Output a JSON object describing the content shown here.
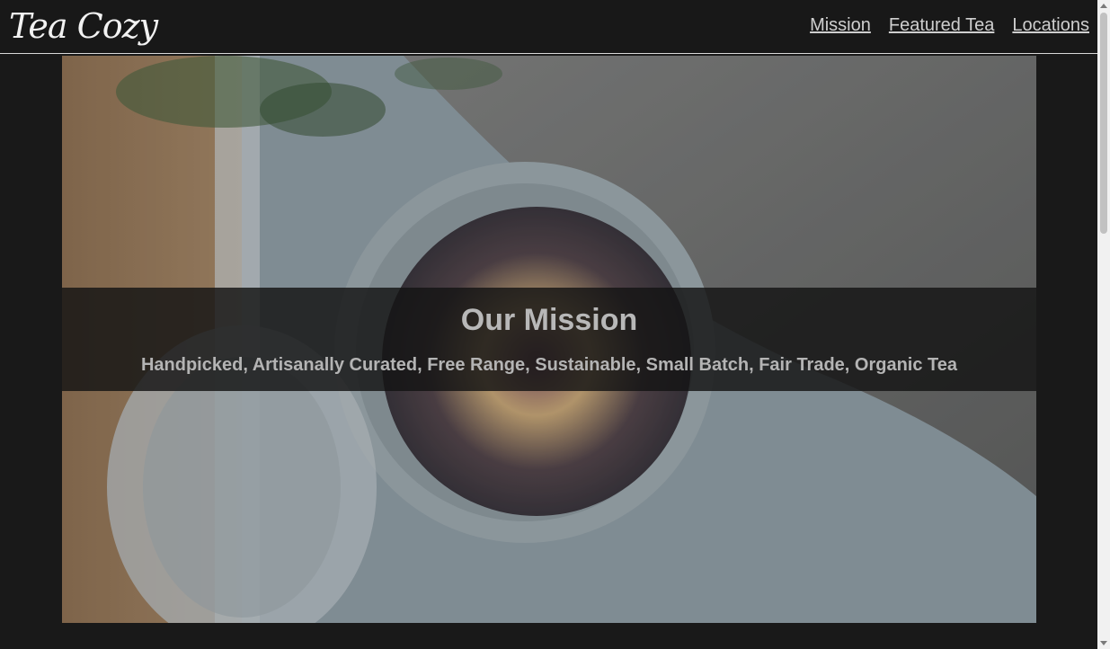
{
  "header": {
    "logo_text": "Tea Cozy",
    "nav": [
      {
        "label": "Mission"
      },
      {
        "label": "Featured Tea"
      },
      {
        "label": "Locations"
      }
    ]
  },
  "hero": {
    "title": "Our Mission",
    "subtitle": "Handpicked, Artisanally Curated, Free Range, Sustainable, Small Batch, Fair Trade, Organic Tea"
  },
  "colors": {
    "page_background": "#191919",
    "header_border": "#d9d9d9",
    "nav_link": "#cfcfcf",
    "mission_band": "#141414"
  }
}
